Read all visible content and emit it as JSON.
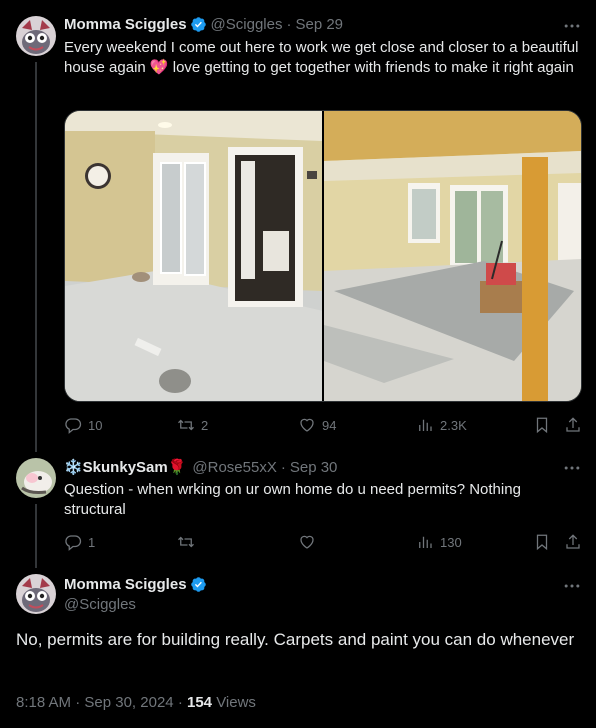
{
  "colors": {
    "background": "#000000",
    "text": "#e7e9ea",
    "muted": "#71767b",
    "verified": "#1d9bf0"
  },
  "tweet1": {
    "name": "Momma Sciggles",
    "handle": "@Sciggles",
    "date": "Sep 29",
    "text": "Every weekend I come out here to work we get close and closer to a beautiful house again 💖 love getting to get together with friends to make it right again",
    "replies": "10",
    "retweets": "2",
    "likes": "94",
    "views": "2.3K",
    "icons": [
      "reply-icon",
      "retweet-icon",
      "like-icon",
      "views-icon",
      "bookmark-icon",
      "share-icon"
    ]
  },
  "tweet2": {
    "name": "❄️SkunkySam🌹",
    "handle": "@Rose55xX",
    "date": "Sep 30",
    "text": "Question - when wrking on ur own home do u need permits? Nothing structural",
    "replies": "1",
    "retweets": "",
    "likes": "",
    "views": "130"
  },
  "tweet3": {
    "name": "Momma Sciggles",
    "handle": "@Sciggles",
    "text": "No, permits are for building really. Carpets and paint you can do whenever",
    "time": "8:18 AM",
    "date": "Sep 30, 2024",
    "views_count": "154",
    "views_label": "Views"
  }
}
